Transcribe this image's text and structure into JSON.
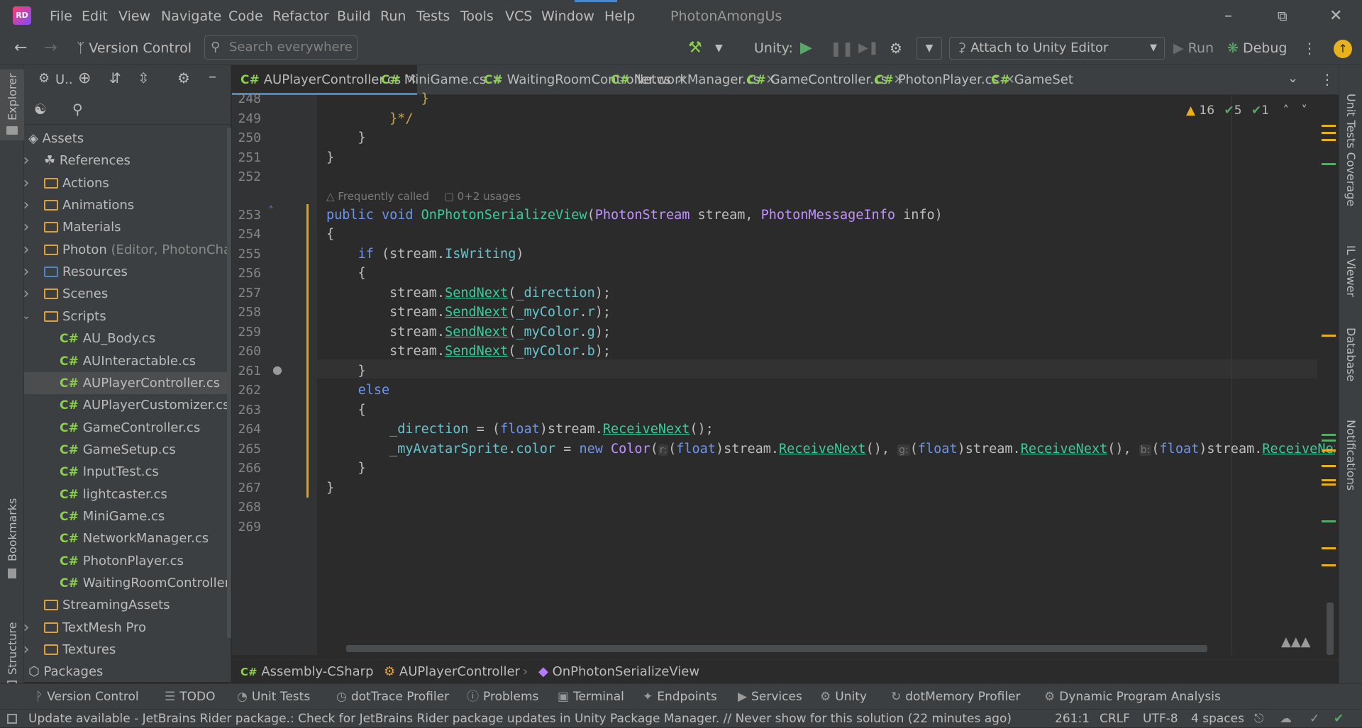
{
  "menubar": {
    "items": [
      "File",
      "Edit",
      "View",
      "Navigate",
      "Code",
      "Refactor",
      "Build",
      "Run",
      "Tests",
      "Tools",
      "VCS",
      "Window",
      "Help"
    ],
    "project": "PhotonAmongUs"
  },
  "toolbar": {
    "vcs_label": "Version Control",
    "search_placeholder": "Search everywhere",
    "unity_label": "Unity:",
    "attach_label": "Attach to Unity Editor",
    "run_label": "Run",
    "debug_label": "Debug"
  },
  "left_strip": {
    "explorer": "Explorer",
    "bookmarks": "Bookmarks",
    "structure": "Structure"
  },
  "explorer": {
    "header_label": "U..",
    "items": [
      {
        "label": "Assets",
        "kind": "root",
        "indent": 0
      },
      {
        "label": "References",
        "kind": "refs",
        "indent": 1,
        "chev": "right"
      },
      {
        "label": "Actions",
        "kind": "folder",
        "indent": 1,
        "chev": "right"
      },
      {
        "label": "Animations",
        "kind": "folder",
        "indent": 1,
        "chev": "right"
      },
      {
        "label": "Materials",
        "kind": "folder",
        "indent": 1,
        "chev": "right"
      },
      {
        "label": "Photon",
        "suffix": " (Editor, PhotonChat,",
        "kind": "folder",
        "indent": 1,
        "chev": "right"
      },
      {
        "label": "Resources",
        "kind": "res",
        "indent": 1,
        "chev": "right"
      },
      {
        "label": "Scenes",
        "kind": "folder",
        "indent": 1,
        "chev": "right"
      },
      {
        "label": "Scripts",
        "kind": "folder",
        "indent": 1,
        "chev": "down"
      },
      {
        "label": "AU_Body.cs",
        "kind": "cs",
        "indent": 2
      },
      {
        "label": "AUInteractable.cs",
        "kind": "cs",
        "indent": 2
      },
      {
        "label": "AUPlayerController.cs",
        "kind": "cs",
        "indent": 2,
        "selected": true
      },
      {
        "label": "AUPlayerCustomizer.cs",
        "kind": "cs",
        "indent": 2
      },
      {
        "label": "GameController.cs",
        "kind": "cs",
        "indent": 2
      },
      {
        "label": "GameSetup.cs",
        "kind": "cs",
        "indent": 2
      },
      {
        "label": "InputTest.cs",
        "kind": "cs",
        "indent": 2
      },
      {
        "label": "lightcaster.cs",
        "kind": "cs",
        "indent": 2
      },
      {
        "label": "MiniGame.cs",
        "kind": "cs",
        "indent": 2
      },
      {
        "label": "NetworkManager.cs",
        "kind": "cs",
        "indent": 2
      },
      {
        "label": "PhotonPlayer.cs",
        "kind": "cs",
        "indent": 2
      },
      {
        "label": "WaitingRoomController.c",
        "kind": "cs",
        "indent": 2
      },
      {
        "label": "StreamingAssets",
        "kind": "folder",
        "indent": 1
      },
      {
        "label": "TextMesh Pro",
        "kind": "folder",
        "indent": 1,
        "chev": "right"
      },
      {
        "label": "Textures",
        "kind": "folder",
        "indent": 1,
        "chev": "right"
      },
      {
        "label": "Packages",
        "kind": "pkg",
        "indent": 0
      }
    ]
  },
  "tabs": [
    {
      "label": "AUPlayerController.cs",
      "active": true,
      "close": true
    },
    {
      "label": "MiniGame.cs",
      "close": true
    },
    {
      "label": "WaitingRoomController.cs",
      "close": true
    },
    {
      "label": "NetworkManager.cs",
      "close": true
    },
    {
      "label": "GameController.cs",
      "close": true
    },
    {
      "label": "PhotonPlayer.cs",
      "close": true
    },
    {
      "label": "GameSet",
      "close": false
    }
  ],
  "inspections": {
    "warnings": "16",
    "weak": "5",
    "ok": "1"
  },
  "codelens": {
    "frequency": "Frequently called",
    "usages": "0+2 usages"
  },
  "code": {
    "l248": "248",
    "l249": "249",
    "l250": "250",
    "l251": "251",
    "l252": "252",
    "l253": "253",
    "l254": "254",
    "l255": "255",
    "l256": "256",
    "l257": "257",
    "l258": "258",
    "l259": "259",
    "l260": "260",
    "l261": "261",
    "l262": "262",
    "l263": "263",
    "l264": "264",
    "l265": "265",
    "l266": "266",
    "l267": "267",
    "l268": "268",
    "l269": "269"
  },
  "breadcrumb": {
    "assembly": "Assembly-CSharp",
    "class": "AUPlayerController",
    "method": "OnPhotonSerializeView"
  },
  "right_strip": {
    "coverage": "Unit Tests Coverage",
    "ilviewer": "IL Viewer",
    "database": "Database",
    "notifications": "Notifications"
  },
  "toolwindows": [
    "Version Control",
    "TODO",
    "Unit Tests",
    "dotTrace Profiler",
    "Problems",
    "Terminal",
    "Endpoints",
    "Services",
    "Unity",
    "dotMemory Profiler",
    "Dynamic Program Analysis"
  ],
  "status": {
    "message": "Update available - JetBrains Rider package.: Check for JetBrains Rider package updates in Unity Package Manager. // Never show for this solution (22 minutes ago)",
    "position": "261:1",
    "eol": "CRLF",
    "encoding": "UTF-8",
    "indent": "4 spaces"
  }
}
